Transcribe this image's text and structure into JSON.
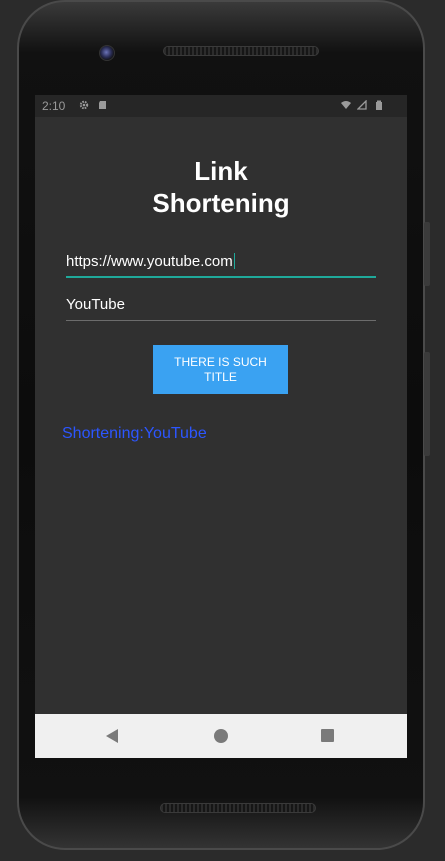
{
  "status_bar": {
    "time": "2:10",
    "icons": [
      "gear-icon",
      "sd-card-icon",
      "wifi-icon",
      "signal-icon",
      "battery-icon"
    ]
  },
  "app": {
    "title_line1": "Link",
    "title_line2": "Shortening",
    "url_field_value": "https://www.youtube.com",
    "title_field_value": "YouTube",
    "check_button_label": "THERE IS SUCH TITLE",
    "result_text": "Shortening:YouTube"
  },
  "nav_bar": {
    "icons": [
      "back-icon",
      "home-icon",
      "recents-icon"
    ]
  },
  "colors": {
    "screen_bg": "#303030",
    "accent_teal": "#1fa99a",
    "button_blue": "#3aa2f2",
    "result_blue": "#2c56ff"
  }
}
